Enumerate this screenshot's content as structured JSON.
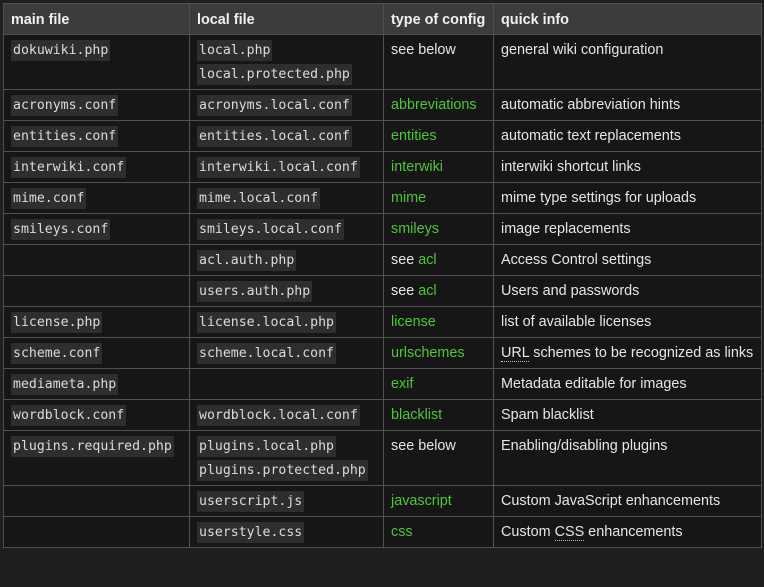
{
  "headers": [
    "main file",
    "local file",
    "type of config",
    "quick info"
  ],
  "rows": [
    {
      "main": "dokuwiki.php",
      "local": [
        "local.php",
        "local.protected.php"
      ],
      "type": {
        "pre": "see below",
        "link": ""
      },
      "info": {
        "pre": "general wiki configuration",
        "abbr": "",
        "post": ""
      }
    },
    {
      "main": "acronyms.conf",
      "local": [
        "acronyms.local.conf"
      ],
      "type": {
        "pre": "",
        "link": "abbreviations"
      },
      "info": {
        "pre": "automatic abbreviation hints",
        "abbr": "",
        "post": ""
      }
    },
    {
      "main": "entities.conf",
      "local": [
        "entities.local.conf"
      ],
      "type": {
        "pre": "",
        "link": "entities"
      },
      "info": {
        "pre": "automatic text replacements",
        "abbr": "",
        "post": ""
      }
    },
    {
      "main": "interwiki.conf",
      "local": [
        "interwiki.local.conf"
      ],
      "type": {
        "pre": "",
        "link": "interwiki"
      },
      "info": {
        "pre": "interwiki shortcut links",
        "abbr": "",
        "post": ""
      }
    },
    {
      "main": "mime.conf",
      "local": [
        "mime.local.conf"
      ],
      "type": {
        "pre": "",
        "link": "mime"
      },
      "info": {
        "pre": "mime type settings for uploads",
        "abbr": "",
        "post": ""
      }
    },
    {
      "main": "smileys.conf",
      "local": [
        "smileys.local.conf"
      ],
      "type": {
        "pre": "",
        "link": "smileys"
      },
      "info": {
        "pre": "image replacements",
        "abbr": "",
        "post": ""
      }
    },
    {
      "main": "",
      "local": [
        "acl.auth.php"
      ],
      "type": {
        "pre": "see ",
        "link": "acl"
      },
      "info": {
        "pre": "Access Control settings",
        "abbr": "",
        "post": ""
      }
    },
    {
      "main": "",
      "local": [
        "users.auth.php"
      ],
      "type": {
        "pre": "see ",
        "link": "acl"
      },
      "info": {
        "pre": "Users and passwords",
        "abbr": "",
        "post": ""
      }
    },
    {
      "main": "license.php",
      "local": [
        "license.local.php"
      ],
      "type": {
        "pre": "",
        "link": "license"
      },
      "info": {
        "pre": "list of available licenses",
        "abbr": "",
        "post": ""
      }
    },
    {
      "main": "scheme.conf",
      "local": [
        "scheme.local.conf"
      ],
      "type": {
        "pre": "",
        "link": "urlschemes"
      },
      "info": {
        "pre": "",
        "abbr": "URL",
        "post": " schemes to be recognized as links"
      }
    },
    {
      "main": "mediameta.php",
      "local": [],
      "type": {
        "pre": "",
        "link": "exif"
      },
      "info": {
        "pre": "Metadata editable for images",
        "abbr": "",
        "post": ""
      }
    },
    {
      "main": "wordblock.conf",
      "local": [
        "wordblock.local.conf"
      ],
      "type": {
        "pre": "",
        "link": "blacklist"
      },
      "info": {
        "pre": "Spam blacklist",
        "abbr": "",
        "post": ""
      }
    },
    {
      "main": "plugins.required.php",
      "local": [
        "plugins.local.php",
        "plugins.protected.php"
      ],
      "type": {
        "pre": "see below",
        "link": ""
      },
      "info": {
        "pre": "Enabling/disabling plugins",
        "abbr": "",
        "post": ""
      }
    },
    {
      "main": "",
      "local": [
        "userscript.js"
      ],
      "type": {
        "pre": "",
        "link": "javascript"
      },
      "info": {
        "pre": "Custom JavaScript enhancements",
        "abbr": "",
        "post": ""
      }
    },
    {
      "main": "",
      "local": [
        "userstyle.css"
      ],
      "type": {
        "pre": "",
        "link": "css"
      },
      "info": {
        "pre": "Custom ",
        "abbr": "CSS",
        "post": " enhancements"
      }
    }
  ],
  "colors": {
    "background": "#161616",
    "header_background": "#3c3c3c",
    "border": "#505050",
    "link": "#4ec63b",
    "code_background": "#2e2e2e"
  }
}
